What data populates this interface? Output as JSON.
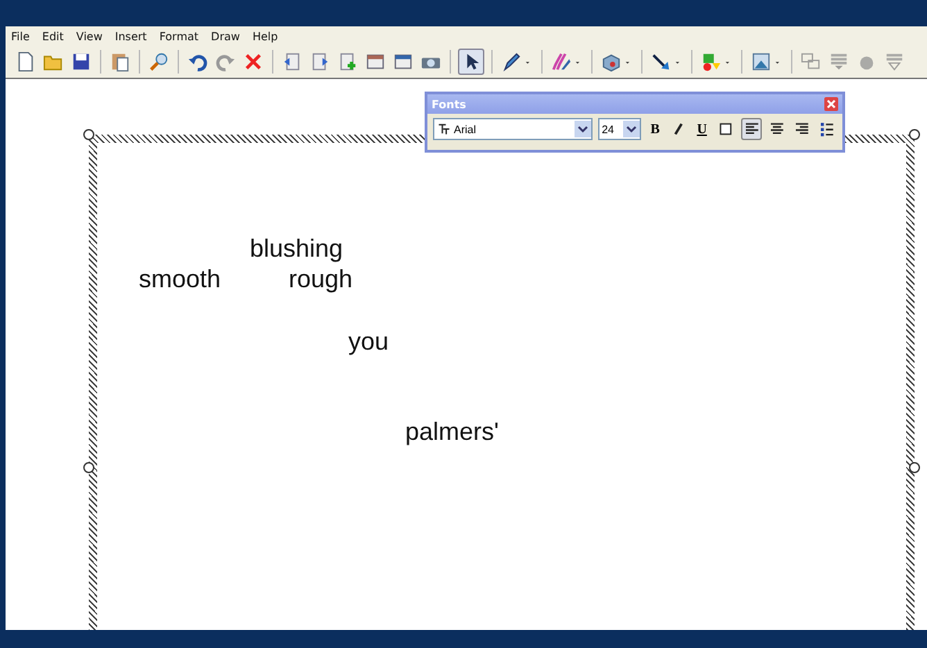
{
  "menu": [
    "File",
    "Edit",
    "View",
    "Insert",
    "Format",
    "Draw",
    "Help"
  ],
  "draw_tools": [
    {
      "kind": "pointer",
      "selected": true
    },
    {
      "kind": "pen",
      "selected": false
    },
    {
      "kind": "brush",
      "selected": false
    },
    {
      "kind": "shape",
      "selected": false
    },
    {
      "kind": "connector",
      "selected": false
    },
    {
      "kind": "fill",
      "selected": false
    },
    {
      "kind": "image",
      "selected": false
    }
  ],
  "fonts_panel": {
    "title": "Fonts",
    "font": "Arial",
    "size": "24",
    "bold": "B",
    "underline": "U",
    "alignments": [
      {
        "selected": true
      },
      {
        "selected": false
      },
      {
        "selected": false
      }
    ]
  },
  "words": [
    "blushing",
    "smooth",
    "rough",
    "you",
    "palmers'"
  ]
}
